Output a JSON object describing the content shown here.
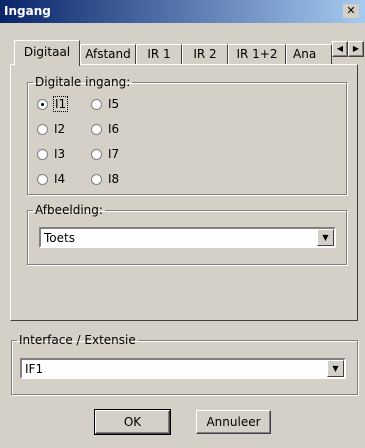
{
  "window": {
    "title": "Ingang",
    "close_glyph": "✕"
  },
  "tabs": [
    {
      "label": "Digitaal"
    },
    {
      "label": "Afstand"
    },
    {
      "label": "IR 1"
    },
    {
      "label": "IR 2"
    },
    {
      "label": "IR 1+2"
    },
    {
      "label": "Ana"
    }
  ],
  "tab_scroll": {
    "left": "◀",
    "right": "▶"
  },
  "digital_group": {
    "legend": "Digitale ingang:",
    "options": [
      {
        "label": "I1",
        "checked": true
      },
      {
        "label": "I2",
        "checked": false
      },
      {
        "label": "I3",
        "checked": false
      },
      {
        "label": "I4",
        "checked": false
      },
      {
        "label": "I5",
        "checked": false
      },
      {
        "label": "I6",
        "checked": false
      },
      {
        "label": "I7",
        "checked": false
      },
      {
        "label": "I8",
        "checked": false
      }
    ]
  },
  "image_group": {
    "legend": "Afbeelding:",
    "value": "Toets"
  },
  "interface_group": {
    "legend": "Interface / Extensie",
    "value": "IF1"
  },
  "buttons": {
    "ok": "OK",
    "cancel": "Annuleer"
  },
  "dropdown_glyph": "▼",
  "colors": {
    "titlebar_start": "#0a246a",
    "titlebar_end": "#a6caf0",
    "face": "#d4d0c8"
  }
}
